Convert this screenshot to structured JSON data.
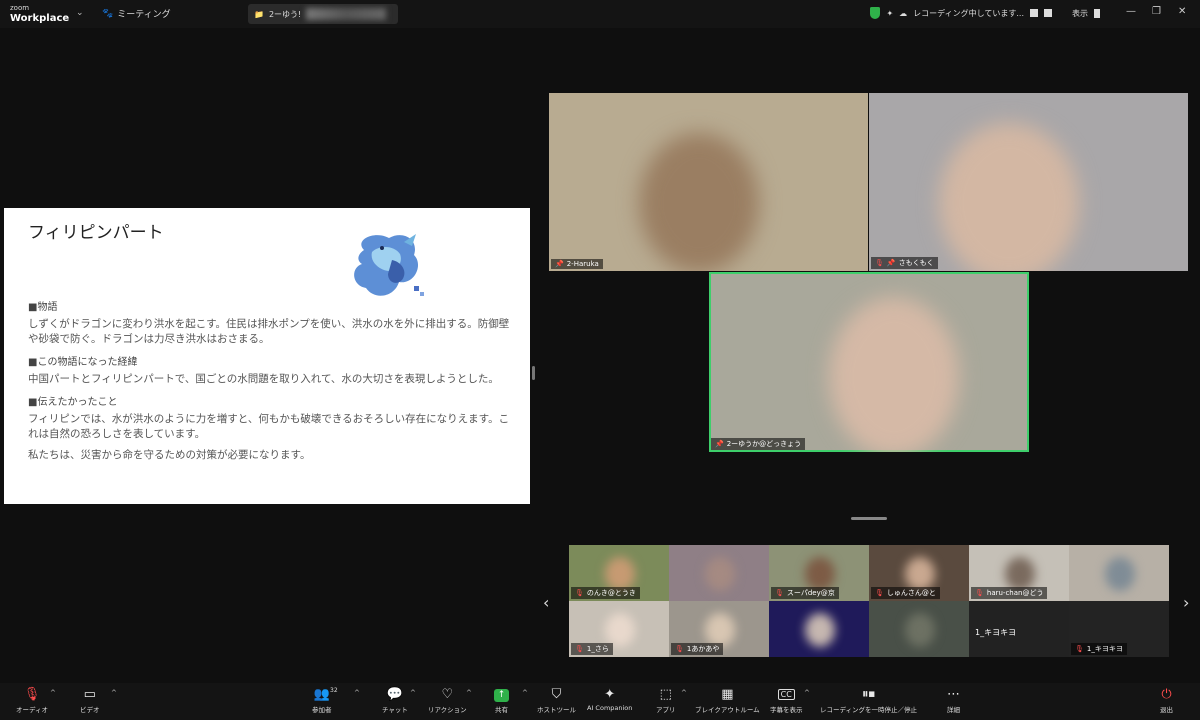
{
  "app": {
    "brand_small": "zoom",
    "brand_big": "Workplace",
    "meeting_menu": "ミーティング",
    "tab_title": "2ーゆう!",
    "recording_status": "レコーディング中しています...",
    "view_label": "表示"
  },
  "slide": {
    "title": "フィリピンパート",
    "sections": [
      {
        "heading": "■物語",
        "text": "しずくがドラゴンに変わり洪水を起こす。住民は排水ポンプを使い、洪水の水を外に排出する。防御壁や砂袋で防ぐ。ドラゴンは力尽き洪水はおさまる。"
      },
      {
        "heading": "■この物語になった経緯",
        "text": "中国パートとフィリピンパートで、国ごとの水問題を取り入れて、水の大切さを表現しようとした。"
      },
      {
        "heading": "■伝えたかったこと",
        "text": "フィリピンでは、水が洪水のように力を増すと、何もかも破壊できるおそろしい存在になりえます。これは自然の恐ろしさを表しています。"
      },
      {
        "heading": "",
        "text": "私たちは、災害から命を守るための対策が必要になります。"
      }
    ]
  },
  "speakers": [
    {
      "name": "2-Haruka",
      "bg": "#b8ab91",
      "face": "#9a7e62"
    },
    {
      "name": "さもくもく",
      "bg": "#a9a7a9",
      "face": "#d3b7a3"
    },
    {
      "name": "2ーゆうか@どっきょう",
      "bg": "#a9a89b",
      "face": "#d5b9a6"
    }
  ],
  "gallery": [
    {
      "name": "のんき@とうき",
      "bg": "#7c8b5a",
      "face": "#c79a72"
    },
    {
      "name": "",
      "bg": "#8f7f86",
      "face": "#a58a82"
    },
    {
      "name": "スーパdey@京",
      "bg": "#8d9276",
      "face": "#7d5b45"
    },
    {
      "name": "しゅんさん@と",
      "bg": "#5a4a3e",
      "face": "#c9a890"
    },
    {
      "name": "haru-chan@どう",
      "bg": "#c5c0b7",
      "face": "#7a6a5e"
    },
    {
      "name": "",
      "bg": "#b7b0a6",
      "face": "#7f8c96"
    },
    {
      "name": "1_さら",
      "bg": "#c7c0b6",
      "face": "#e8d8cc"
    },
    {
      "name": "1あかあや",
      "bg": "#9c968d",
      "face": "#d8c6b2"
    },
    {
      "name": "",
      "bg": "#1f1a5a",
      "face": "#c6b7b0"
    },
    {
      "name": "",
      "bg": "#495048",
      "face": "#6d7163"
    },
    {
      "name": "1_キヨキヨ",
      "bg": "#222222",
      "face": "#2c2c2c"
    },
    {
      "name": "1_キヨキヨ",
      "bg": "#232323",
      "face": "#2e2e2e"
    }
  ],
  "toolbar": {
    "audio": "オーディオ",
    "video": "ビデオ",
    "participants": "参加者",
    "participant_count": "32",
    "chat": "チャット",
    "reactions": "リアクション",
    "share": "共有",
    "host_tools": "ホストツール",
    "ai_companion": "AI Companion",
    "apps": "アプリ",
    "breakout": "ブレイクアウトルーム",
    "captions": "字幕を表示",
    "captions_icon": "CC",
    "recording": "レコーディングを一時停止／停止",
    "more": "詳細",
    "leave": "退出"
  },
  "colors": {
    "active_speaker": "#3ecf6b",
    "share_green": "#2fb14a",
    "muted_red": "#ff4d4d"
  }
}
